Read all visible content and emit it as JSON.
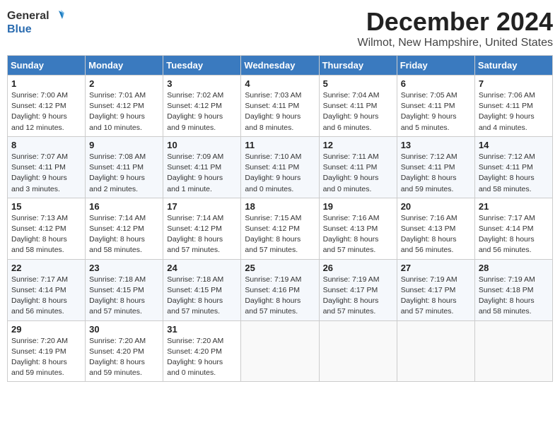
{
  "header": {
    "logo_line1": "General",
    "logo_line2": "Blue",
    "month": "December 2024",
    "location": "Wilmot, New Hampshire, United States"
  },
  "weekdays": [
    "Sunday",
    "Monday",
    "Tuesday",
    "Wednesday",
    "Thursday",
    "Friday",
    "Saturday"
  ],
  "weeks": [
    [
      {
        "day": "1",
        "info": "Sunrise: 7:00 AM\nSunset: 4:12 PM\nDaylight: 9 hours\nand 12 minutes."
      },
      {
        "day": "2",
        "info": "Sunrise: 7:01 AM\nSunset: 4:12 PM\nDaylight: 9 hours\nand 10 minutes."
      },
      {
        "day": "3",
        "info": "Sunrise: 7:02 AM\nSunset: 4:12 PM\nDaylight: 9 hours\nand 9 minutes."
      },
      {
        "day": "4",
        "info": "Sunrise: 7:03 AM\nSunset: 4:11 PM\nDaylight: 9 hours\nand 8 minutes."
      },
      {
        "day": "5",
        "info": "Sunrise: 7:04 AM\nSunset: 4:11 PM\nDaylight: 9 hours\nand 6 minutes."
      },
      {
        "day": "6",
        "info": "Sunrise: 7:05 AM\nSunset: 4:11 PM\nDaylight: 9 hours\nand 5 minutes."
      },
      {
        "day": "7",
        "info": "Sunrise: 7:06 AM\nSunset: 4:11 PM\nDaylight: 9 hours\nand 4 minutes."
      }
    ],
    [
      {
        "day": "8",
        "info": "Sunrise: 7:07 AM\nSunset: 4:11 PM\nDaylight: 9 hours\nand 3 minutes."
      },
      {
        "day": "9",
        "info": "Sunrise: 7:08 AM\nSunset: 4:11 PM\nDaylight: 9 hours\nand 2 minutes."
      },
      {
        "day": "10",
        "info": "Sunrise: 7:09 AM\nSunset: 4:11 PM\nDaylight: 9 hours\nand 1 minute."
      },
      {
        "day": "11",
        "info": "Sunrise: 7:10 AM\nSunset: 4:11 PM\nDaylight: 9 hours\nand 0 minutes."
      },
      {
        "day": "12",
        "info": "Sunrise: 7:11 AM\nSunset: 4:11 PM\nDaylight: 9 hours\nand 0 minutes."
      },
      {
        "day": "13",
        "info": "Sunrise: 7:12 AM\nSunset: 4:11 PM\nDaylight: 8 hours\nand 59 minutes."
      },
      {
        "day": "14",
        "info": "Sunrise: 7:12 AM\nSunset: 4:11 PM\nDaylight: 8 hours\nand 58 minutes."
      }
    ],
    [
      {
        "day": "15",
        "info": "Sunrise: 7:13 AM\nSunset: 4:12 PM\nDaylight: 8 hours\nand 58 minutes."
      },
      {
        "day": "16",
        "info": "Sunrise: 7:14 AM\nSunset: 4:12 PM\nDaylight: 8 hours\nand 58 minutes."
      },
      {
        "day": "17",
        "info": "Sunrise: 7:14 AM\nSunset: 4:12 PM\nDaylight: 8 hours\nand 57 minutes."
      },
      {
        "day": "18",
        "info": "Sunrise: 7:15 AM\nSunset: 4:12 PM\nDaylight: 8 hours\nand 57 minutes."
      },
      {
        "day": "19",
        "info": "Sunrise: 7:16 AM\nSunset: 4:13 PM\nDaylight: 8 hours\nand 57 minutes."
      },
      {
        "day": "20",
        "info": "Sunrise: 7:16 AM\nSunset: 4:13 PM\nDaylight: 8 hours\nand 56 minutes."
      },
      {
        "day": "21",
        "info": "Sunrise: 7:17 AM\nSunset: 4:14 PM\nDaylight: 8 hours\nand 56 minutes."
      }
    ],
    [
      {
        "day": "22",
        "info": "Sunrise: 7:17 AM\nSunset: 4:14 PM\nDaylight: 8 hours\nand 56 minutes."
      },
      {
        "day": "23",
        "info": "Sunrise: 7:18 AM\nSunset: 4:15 PM\nDaylight: 8 hours\nand 57 minutes."
      },
      {
        "day": "24",
        "info": "Sunrise: 7:18 AM\nSunset: 4:15 PM\nDaylight: 8 hours\nand 57 minutes."
      },
      {
        "day": "25",
        "info": "Sunrise: 7:19 AM\nSunset: 4:16 PM\nDaylight: 8 hours\nand 57 minutes."
      },
      {
        "day": "26",
        "info": "Sunrise: 7:19 AM\nSunset: 4:17 PM\nDaylight: 8 hours\nand 57 minutes."
      },
      {
        "day": "27",
        "info": "Sunrise: 7:19 AM\nSunset: 4:17 PM\nDaylight: 8 hours\nand 57 minutes."
      },
      {
        "day": "28",
        "info": "Sunrise: 7:19 AM\nSunset: 4:18 PM\nDaylight: 8 hours\nand 58 minutes."
      }
    ],
    [
      {
        "day": "29",
        "info": "Sunrise: 7:20 AM\nSunset: 4:19 PM\nDaylight: 8 hours\nand 59 minutes."
      },
      {
        "day": "30",
        "info": "Sunrise: 7:20 AM\nSunset: 4:20 PM\nDaylight: 8 hours\nand 59 minutes."
      },
      {
        "day": "31",
        "info": "Sunrise: 7:20 AM\nSunset: 4:20 PM\nDaylight: 9 hours\nand 0 minutes."
      },
      {
        "day": "",
        "info": ""
      },
      {
        "day": "",
        "info": ""
      },
      {
        "day": "",
        "info": ""
      },
      {
        "day": "",
        "info": ""
      }
    ]
  ]
}
